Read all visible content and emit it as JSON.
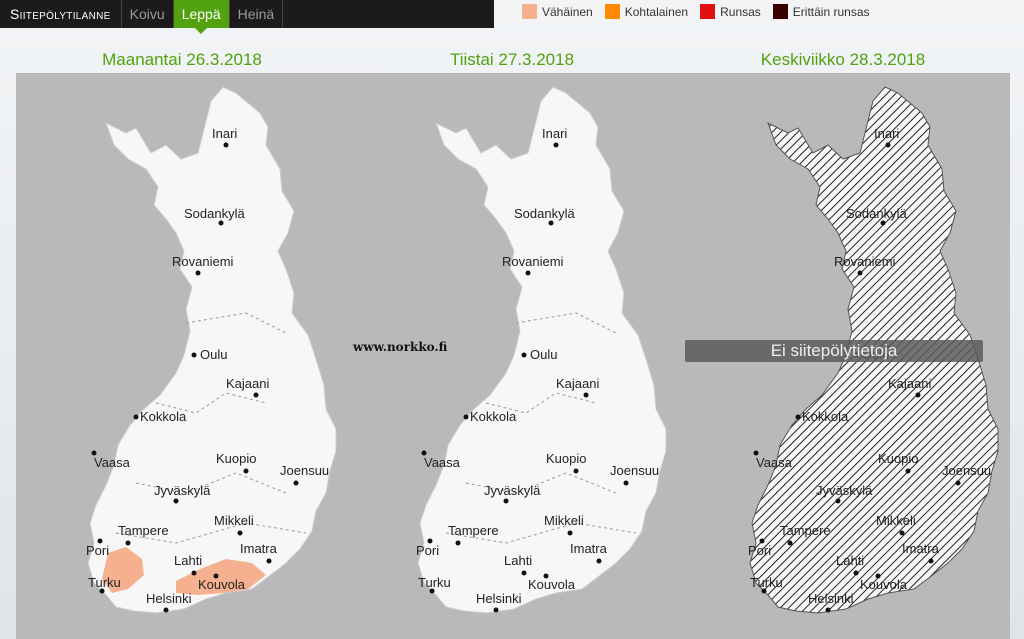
{
  "nav": {
    "title": "Siitepölytilanne",
    "tabs": [
      {
        "label": "Koivu",
        "active": false
      },
      {
        "label": "Leppä",
        "active": true
      },
      {
        "label": "Heinä",
        "active": false
      }
    ]
  },
  "legend": [
    {
      "label": "Vähäinen",
      "color": "#f4b08f"
    },
    {
      "label": "Kohtalainen",
      "color": "#ff8a00"
    },
    {
      "label": "Runsas",
      "color": "#e01010"
    },
    {
      "label": "Erittäin runsas",
      "color": "#3a0000"
    }
  ],
  "days": [
    {
      "title": "Maanantai 26.3.2018"
    },
    {
      "title": "Tiistai 27.3.2018"
    },
    {
      "title": "Keskiviikko 28.3.2018"
    }
  ],
  "watermark": "www.norkko.fi",
  "no_data_text": "Ei siitepölytietoja",
  "cities": [
    "Inari",
    "Sodankylä",
    "Rovaniemi",
    "Oulu",
    "Kajaani",
    "Kokkola",
    "Vaasa",
    "Kuopio",
    "Joensuu",
    "Jyväskylä",
    "Tampere",
    "Mikkeli",
    "Pori",
    "Lahti",
    "Imatra",
    "Turku",
    "Kouvola",
    "Helsinki"
  ],
  "colors": {
    "accent": "#52a10f",
    "map_bg": "#b9b9b9",
    "land": "#f7f7f7"
  }
}
